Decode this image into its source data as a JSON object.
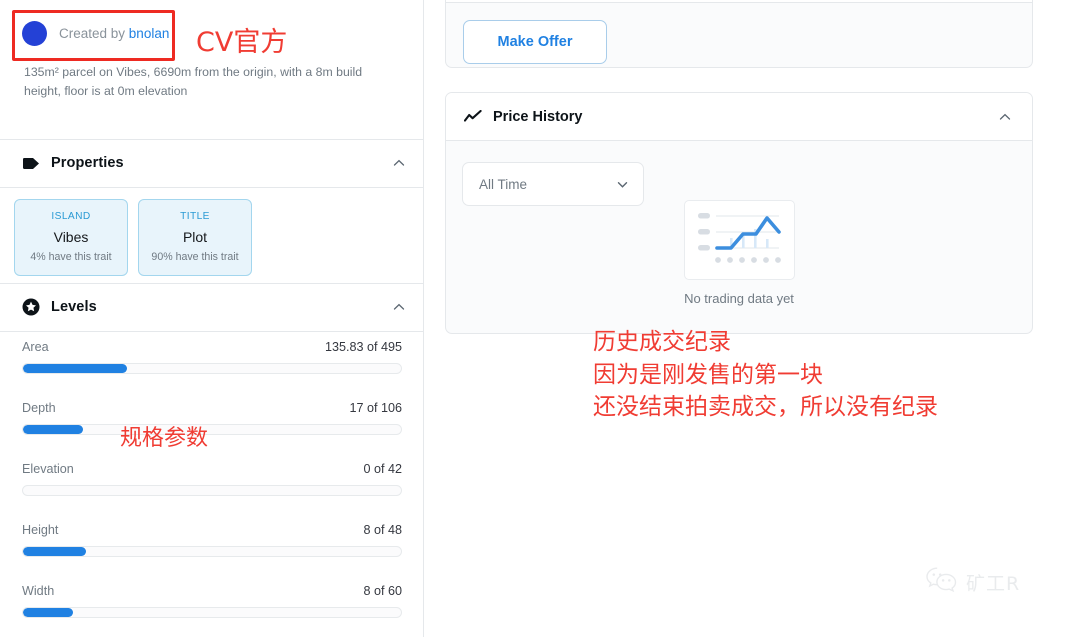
{
  "left_panel": {
    "creator": {
      "prefix": "Created by ",
      "name": "bnolan",
      "avatar_color": "#2441d6"
    },
    "description": "135m² parcel on Vibes, 6690m from the origin, with a 8m build height, floor is at 0m elevation",
    "properties_section": {
      "title": "Properties",
      "icon": "tag-icon",
      "collapse_icon": "chevron-up-icon",
      "traits": [
        {
          "type": "ISLAND",
          "value": "Vibes",
          "rarity": "4% have this trait"
        },
        {
          "type": "TITLE",
          "value": "Plot",
          "rarity": "90% have this trait"
        }
      ]
    },
    "levels_section": {
      "title": "Levels",
      "icon": "star-circle-icon",
      "collapse_icon": "chevron-up-icon",
      "levels": [
        {
          "name": "Area",
          "value": "135.83 of 495",
          "current": 135.83,
          "max": 495,
          "percent": 27.4
        },
        {
          "name": "Depth",
          "value": "17 of 106",
          "current": 17,
          "max": 106,
          "percent": 16.0
        },
        {
          "name": "Elevation",
          "value": "0 of 42",
          "current": 0,
          "max": 42,
          "percent": 0
        },
        {
          "name": "Height",
          "value": "8 of 48",
          "current": 8,
          "max": 48,
          "percent": 16.7
        },
        {
          "name": "Width",
          "value": "8 of 60",
          "current": 8,
          "max": 60,
          "percent": 13.3
        }
      ]
    }
  },
  "right_panel": {
    "make_offer_label": "Make Offer",
    "price_history": {
      "title": "Price History",
      "icon": "line-chart-icon",
      "collapse_icon": "chevron-up-icon",
      "time_filter": {
        "selected": "All Time",
        "chevron": "chevron-down-icon"
      },
      "empty_state": {
        "caption": "No trading data yet",
        "illustration": "empty-chart-icon"
      }
    }
  },
  "annotations": {
    "color": "#f03c33",
    "creator_note": "CV官方",
    "levels_note": "规格参数",
    "history_note": "历史成交纪录\n因为是刚发售的第一块\n还没结束拍卖成交，所以没有纪录"
  },
  "watermark": {
    "icon": "wechat-icon",
    "text": "矿工R"
  }
}
